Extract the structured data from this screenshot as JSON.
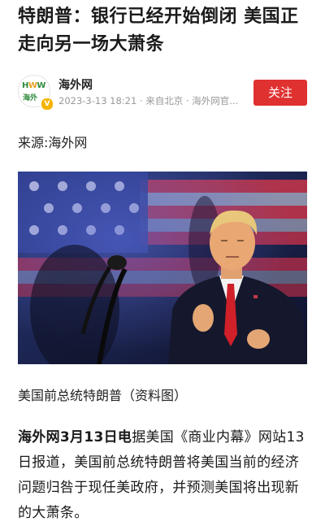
{
  "article": {
    "title": "特朗普：银行已经开始倒闭 美国正走向另一场大萧条",
    "source": {
      "name": "海外网",
      "meta": "2023-3-13 18:21 · 来自北京 · 海外网官...",
      "follow_label": "关注",
      "verified_badge": "V"
    },
    "origin": "来源:海外网",
    "image_caption": "美国前总统特朗普（资料图）",
    "body_lead": "海外网3月13日电",
    "body_rest": "据美国《商业内幕》网站13日报道，美国前总统特朗普将美国当前的经济问题归咎于现任美政府，并预测美国将出现新的大萧条。"
  },
  "colors": {
    "follow_bg": "#e03131",
    "meta_text": "#999999"
  }
}
